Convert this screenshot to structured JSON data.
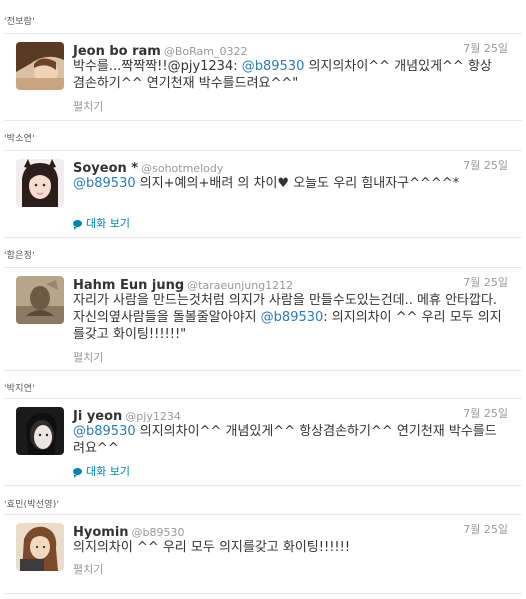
{
  "colors": {
    "link": "#2b7bb9",
    "muted": "#999999",
    "text": "#333333"
  },
  "tweets": [
    {
      "section_label": "'전보람'",
      "name": "Jeon bo ram",
      "handle": "@BoRam_0322",
      "date": "7월 25일",
      "text_before": "박수를...짝짝짝!!@pjy1234: ",
      "mention": "@b89530",
      "text_after": " 의지의차이^^ 개념있게^^ 항상겸손하기^^ 연기천재 박수를드려요^^\"",
      "action": "펼치기",
      "avatar_icon": "profile-photo"
    },
    {
      "section_label": "'박소연'",
      "name": "Soyeon *",
      "handle": "@sohotmelody",
      "date": "7월 25일",
      "text_before": "",
      "mention": "@b89530",
      "text_after": " 의지+예의+배려 의 차이♥ 오늘도 우리 힘내자구^^^^*",
      "action": "대화 보기",
      "avatar_icon": "profile-photo"
    },
    {
      "section_label": "'함은정'",
      "name": "Hahm Eun jung",
      "handle": "@taraeunjung1212",
      "date": "7월 25일",
      "text_before": "자리가 사람을 만드는것처럼 의지가 사람을 만들수도있는건데.. 메휴 안타깝다. 자신의옆사람들을 돌볼줄알아야지 ",
      "mention": "@b89530",
      "text_after": ": 의지의차이 ^^ 우리 모두 의지를갖고 화이팅!!!!!!\"",
      "action": "펼치기",
      "avatar_icon": "profile-photo"
    },
    {
      "section_label": "'박지연'",
      "name": "Ji yeon",
      "handle": "@pjy1234",
      "date": "7월 25일",
      "text_before": "",
      "mention": "@b89530",
      "text_after": " 의지의차이^^ 개념있게^^ 항상겸손하기^^ 연기천재 박수를드려요^^",
      "action": "대화 보기",
      "avatar_icon": "profile-photo"
    },
    {
      "section_label": "'효민(박선영)'",
      "name": "Hyomin",
      "handle": "@b89530",
      "date": "7월 25일",
      "text_before": "의지의차이 ^^ 우리 모두 의지를갖고 화이팅!!!!!!",
      "mention": "",
      "text_after": "",
      "action": "펼치기",
      "avatar_icon": "profile-photo"
    }
  ]
}
